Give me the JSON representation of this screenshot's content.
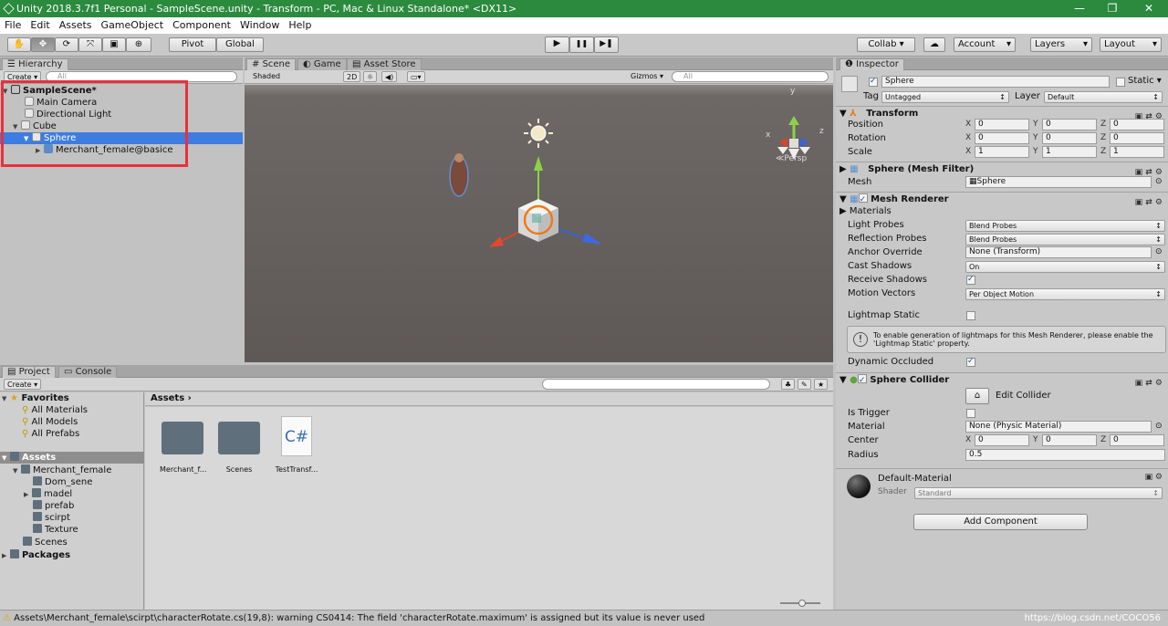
{
  "window": {
    "title": "Unity 2018.3.7f1 Personal - SampleScene.unity - Transform - PC, Mac & Linux Standalone* <DX11>",
    "min": "—",
    "max": "❐",
    "close": "✕"
  },
  "menu": [
    "File",
    "Edit",
    "Assets",
    "GameObject",
    "Component",
    "Window",
    "Help"
  ],
  "toolbar": {
    "pivot": "Pivot",
    "global": "Global",
    "play": "▶",
    "pause": "❚❚",
    "step": "▶❚",
    "collab": "Collab ▾",
    "cloud": "☁",
    "account": "Account",
    "layers": "Layers",
    "layout": "Layout"
  },
  "hierarchy": {
    "tab": "Hierarchy",
    "create": "Create ▾",
    "search_placeholder": "All",
    "scene": "SampleScene*",
    "items": [
      "Main Camera",
      "Directional Light",
      "Cube",
      "Sphere",
      "Merchant_female@basice"
    ]
  },
  "scene": {
    "tabs": [
      "Scene",
      "Game",
      "Asset Store"
    ],
    "shading": "Shaded",
    "mode2d": "2D",
    "gizmos": "Gizmos ▾",
    "search_placeholder": "All",
    "persp": "≪Persp",
    "axis_x": "x",
    "axis_y": "y",
    "axis_z": "z"
  },
  "project": {
    "tabs": [
      "Project",
      "Console"
    ],
    "create": "Create ▾",
    "favorites": "Favorites",
    "fav_items": [
      "All Materials",
      "All Models",
      "All Prefabs"
    ],
    "assets": "Assets",
    "merchant": "Merchant_female",
    "merchant_children": [
      "Dom_sene",
      "madel",
      "prefab",
      "scirpt",
      "Texture"
    ],
    "scenes": "Scenes",
    "packages": "Packages",
    "breadcrumb": "Assets ›",
    "files": [
      {
        "name": "Merchant_f...",
        "kind": "folder"
      },
      {
        "name": "Scenes",
        "kind": "folder"
      },
      {
        "name": "TestTransf...",
        "kind": "script",
        "glyph": "C#"
      }
    ]
  },
  "inspector": {
    "tab": "Inspector",
    "name": "Sphere",
    "static": "Static ▾",
    "tag_label": "Tag",
    "tag": "Untagged",
    "layer_label": "Layer",
    "layer": "Default",
    "transform": {
      "title": "Transform",
      "rows": [
        {
          "label": "Position",
          "x": "0",
          "y": "0",
          "z": "0"
        },
        {
          "label": "Rotation",
          "x": "0",
          "y": "0",
          "z": "0"
        },
        {
          "label": "Scale",
          "x": "1",
          "y": "1",
          "z": "1"
        }
      ]
    },
    "meshfilter": {
      "title": "Sphere (Mesh Filter)",
      "mesh_label": "Mesh",
      "mesh": "Sphere"
    },
    "renderer": {
      "title": "Mesh Renderer",
      "materials": "Materials",
      "light_probes_l": "Light Probes",
      "light_probes": "Blend Probes",
      "refl_l": "Reflection Probes",
      "refl": "Blend Probes",
      "anchor_l": "Anchor Override",
      "anchor": "None (Transform)",
      "cast_l": "Cast Shadows",
      "cast": "On",
      "recv_l": "Receive Shadows",
      "motion_l": "Motion Vectors",
      "motion": "Per Object Motion",
      "lmstatic_l": "Lightmap Static",
      "info": "To enable generation of lightmaps for this Mesh Renderer, please enable the 'Lightmap Static' property.",
      "dyn_l": "Dynamic Occluded"
    },
    "collider": {
      "title": "Sphere Collider",
      "edit": "Edit Collider",
      "trigger_l": "Is Trigger",
      "mat_l": "Material",
      "mat": "None (Physic Material)",
      "center_l": "Center",
      "cx": "0",
      "cy": "0",
      "cz": "0",
      "radius_l": "Radius",
      "radius": "0.5"
    },
    "material": {
      "name": "Default-Material",
      "shader_l": "Shader",
      "shader": "Standard"
    },
    "add_component": "Add Component"
  },
  "status": {
    "text": "Assets\\Merchant_female\\scirpt\\characterRotate.cs(19,8): warning CS0414: The field 'characterRotate.maximum' is assigned but its value is never used",
    "watermark": "https://blog.csdn.net/COCO56"
  }
}
